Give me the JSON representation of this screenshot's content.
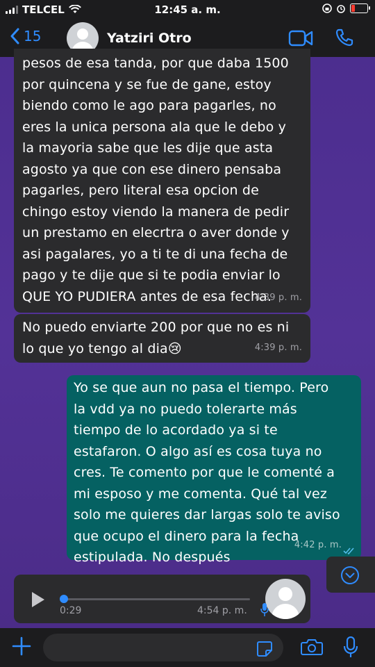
{
  "status_bar": {
    "carrier": "TELCEL",
    "time": "12:45 a. m."
  },
  "header": {
    "back_count": "15",
    "contact_name": "Yatziri Otro"
  },
  "messages": [
    {
      "direction": "in",
      "text": "pesos de esa tanda, por que daba 1500\npor quincena y se fue de gane, estoy\nbiendo como le ago para pagarles, no\neres la unica persona ala que le debo y\nla mayoria sabe que les dije que asta\nagosto ya que con ese dinero pensaba\npagarles, pero literal esa opcion de\nchingo estoy viendo la manera de pedir\nun prestamo en elecrtra o aver donde y\nasi pagalares, yo a ti te di una fecha de\npago y te dije que si te podia enviar lo\nQUE YO PUDIERA antes de esa fecha.",
      "time": "4:39 p. m."
    },
    {
      "direction": "in",
      "text": "No puedo enviarte 200 por que no es ni\nlo que yo tengo al dia😢",
      "time": "4:39 p. m."
    },
    {
      "direction": "out",
      "text": "Yo se que aun  no pasa el tiempo. Pero\nla vdd ya no puedo tolerarte más\ntiempo de lo acordado ya si te\nestafaron. O algo así es cosa tuya no\ncres. Te  comento por que le comenté a\nmi esposo  y me comenta. Qué tal vez\nsolo me quieres dar largas solo te aviso\nque ocupo el dinero para la fecha\nestipulada.  No después",
      "time": "4:42 p. m."
    }
  ],
  "voice_note": {
    "duration": "0:29",
    "time": "4:54 p. m.",
    "progress": 0
  },
  "icons": {
    "back": "chevron-left-icon",
    "video": "video-call-icon",
    "phone": "phone-call-icon",
    "scroll": "chevron-down-circle-icon",
    "plus": "plus-icon",
    "sticker": "sticker-icon",
    "camera": "camera-icon",
    "mic": "microphone-icon"
  },
  "colors": {
    "accent": "#2f8cff",
    "outgoing_bubble": "#056162",
    "incoming_bubble": "#2b2b2d",
    "read_ticks": "#53bdeb",
    "battery_low": "#ff3b30"
  }
}
